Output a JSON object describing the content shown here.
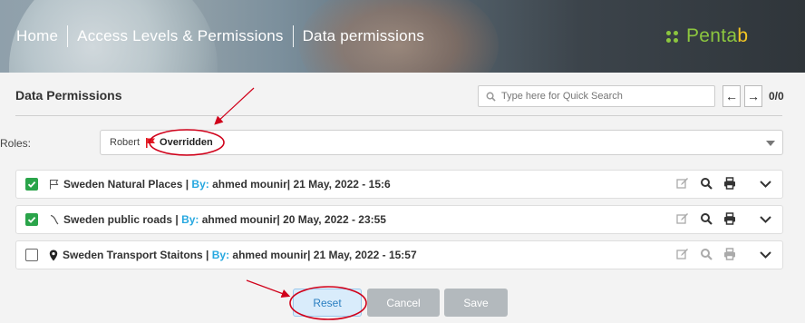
{
  "header": {
    "breadcrumb": [
      "Home",
      "Access Levels & Permissions",
      "Data permissions"
    ],
    "logo_main": "Penta",
    "logo_suffix": "b"
  },
  "page": {
    "title": "Data Permissions",
    "search_placeholder": "Type here for Quick Search",
    "pager": "0/0",
    "prev_label": "←",
    "next_label": "→"
  },
  "roles": {
    "label": "Roles:",
    "selected_name": "Robert",
    "selected_status": "Overridden"
  },
  "rows": [
    {
      "checked": true,
      "icon": "flag-outline-icon",
      "name": "Sweden Natural Places",
      "by_label": "By:",
      "author_date": "ahmed mounir| 21 May, 2022 - 15:6",
      "actions_enabled": true
    },
    {
      "checked": true,
      "icon": "road-line-icon",
      "name": "Sweden public roads",
      "by_label": "By:",
      "author_date": "ahmed mounir| 20 May, 2022 - 23:55",
      "actions_enabled": true
    },
    {
      "checked": false,
      "icon": "map-marker-icon",
      "name": "Sweden Transport Staitons",
      "by_label": "By:",
      "author_date": "ahmed mounir| 21 May, 2022 - 15:57",
      "actions_enabled": false
    }
  ],
  "buttons": {
    "reset": "Reset",
    "cancel": "Cancel",
    "save": "Save"
  },
  "colors": {
    "accent_blue": "#27a8e0",
    "check_green": "#2aa44a",
    "logo_green": "#8cc63f",
    "logo_yellow": "#f3c623",
    "flag_red": "#e31b23",
    "annotation_red": "#d0021b"
  }
}
